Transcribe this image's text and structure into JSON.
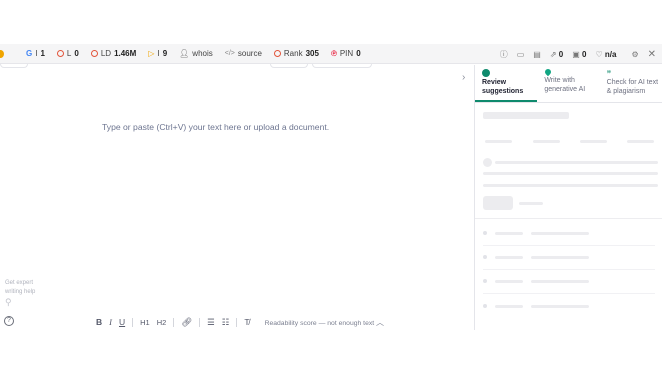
{
  "seo": {
    "g_label": "I",
    "g_value": "1",
    "l_label": "L",
    "l_value": "0",
    "ld_label": "LD",
    "ld_value": "1.46M",
    "i_label": "I",
    "i_value": "9",
    "whois": "whois",
    "source": "source",
    "rank_label": "Rank",
    "rank_value": "305",
    "pin_label": "PIN",
    "pin_value": "0",
    "right_v1": "0",
    "right_v2": "0",
    "right_na": "n/a",
    "source_glyph": "</>"
  },
  "editor": {
    "placeholder": "Type or paste (Ctrl+V) your text here or upload a document.",
    "expert_line1": "Get expert",
    "expert_line2": "writing help",
    "readability": "Readability score — not enough text"
  },
  "format": {
    "bold": "B",
    "italic": "I",
    "underline": "U",
    "h1": "H1",
    "h2": "H2"
  },
  "panel": {
    "tab1": "Review suggestions",
    "tab2": "Write with generative AI",
    "tab3": "Check for AI text & plagiarism"
  },
  "colors": {
    "accent": "#0f8a6d",
    "seo_ring": "#e2553b"
  }
}
